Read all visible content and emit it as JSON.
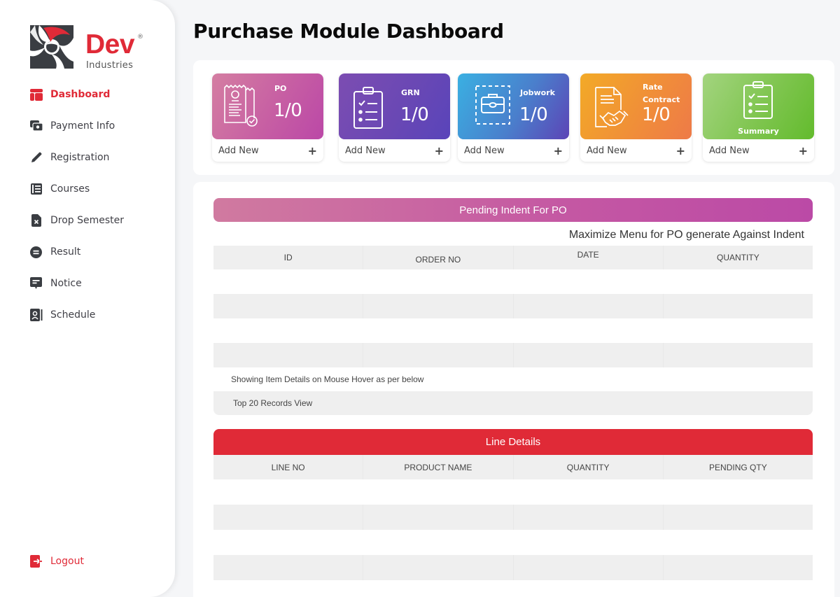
{
  "brand": {
    "name": "Dev",
    "registered": "®",
    "subtitle": "Industries",
    "primary_color": "#e02a37",
    "dark_color": "#3a3d42"
  },
  "sidebar": {
    "items": [
      {
        "label": "Dashboard",
        "icon": "dashboard-icon",
        "active": true
      },
      {
        "label": "Payment Info",
        "icon": "payment-icon",
        "active": false
      },
      {
        "label": "Registration",
        "icon": "pencil-icon",
        "active": false
      },
      {
        "label": "Courses",
        "icon": "courses-icon",
        "active": false
      },
      {
        "label": "Drop Semester",
        "icon": "drop-file-icon",
        "active": false
      },
      {
        "label": "Result",
        "icon": "result-icon",
        "active": false
      },
      {
        "label": "Notice",
        "icon": "notice-icon",
        "active": false
      },
      {
        "label": "Schedule",
        "icon": "schedule-icon",
        "active": false
      }
    ],
    "logout": {
      "label": "Logout",
      "icon": "logout-icon"
    }
  },
  "header": {
    "title": "Purchase Module Dashboard"
  },
  "cards": [
    {
      "title": "PO",
      "count": "1/0",
      "icon": "receipt-icon",
      "action": "Add New",
      "action_icon": "+",
      "gradient": [
        "#d07aa0",
        "#bb4aa6"
      ]
    },
    {
      "title": "GRN",
      "count": "1/0",
      "icon": "clipboard-list-icon",
      "action": "Add New",
      "action_icon": "+",
      "gradient": [
        "#7a4cb0",
        "#5b44b8"
      ]
    },
    {
      "title": "Jobwork",
      "count": "1/0",
      "icon": "briefcase-icon",
      "action": "Add New",
      "action_icon": "+",
      "gradient": [
        "#3aaee0",
        "#5a46b5"
      ]
    },
    {
      "title": "Rate Contract",
      "title_line1": "Rate",
      "title_line2": "Contract",
      "count": "1/0",
      "icon": "contract-handshake-icon",
      "action": "Add New",
      "action_icon": "+",
      "gradient": [
        "#f2a52a",
        "#ef7a45"
      ]
    },
    {
      "title": "Summary",
      "icon": "clipboard-summary-icon",
      "action": "Add New",
      "action_icon": "+",
      "gradient": [
        "#9ed07a",
        "#62bb2e"
      ]
    }
  ],
  "pending_indent": {
    "title": "Pending Indent For PO",
    "hint": "Maximize Menu for PO generate Against Indent",
    "columns": [
      "ID",
      "ORDER NO",
      "DATE",
      "QUANTITY"
    ],
    "rows": [],
    "note_hover": "Showing Item Details on Mouse Hover as per below",
    "note_records": "Top 20 Records View"
  },
  "line_details": {
    "title": "Line Details",
    "columns": [
      "LINE NO",
      "PRODUCT NAME",
      "QUANTITY",
      "PENDING QTY"
    ],
    "rows": []
  }
}
